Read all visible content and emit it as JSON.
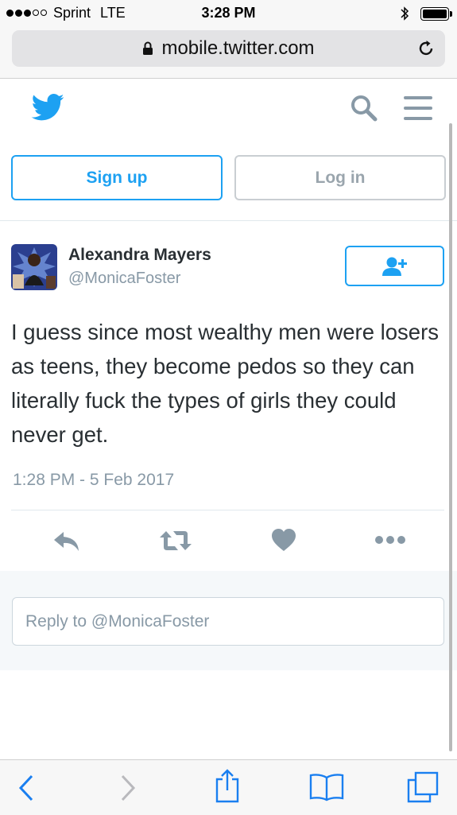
{
  "status_bar": {
    "carrier": "Sprint",
    "network": "LTE",
    "time": "3:28 PM"
  },
  "browser": {
    "url": "mobile.twitter.com"
  },
  "auth": {
    "signup_label": "Sign up",
    "login_label": "Log in"
  },
  "tweet": {
    "display_name": "Alexandra Mayers",
    "handle": "@MonicaFoster",
    "text": "I guess since most wealthy men were losers as teens, they become pedos so they can literally fuck the types of girls they could never get.",
    "timestamp": "1:28 PM - 5 Feb 2017"
  },
  "reply": {
    "placeholder": "Reply to @MonicaFoster"
  },
  "colors": {
    "brand": "#1da1f2",
    "icon_gray": "#8899a6",
    "text": "#292f33"
  },
  "icons": [
    "twitter-bird",
    "search",
    "menu",
    "follow",
    "reply",
    "retweet",
    "like",
    "more",
    "back",
    "forward",
    "share",
    "bookmarks",
    "tabs"
  ]
}
